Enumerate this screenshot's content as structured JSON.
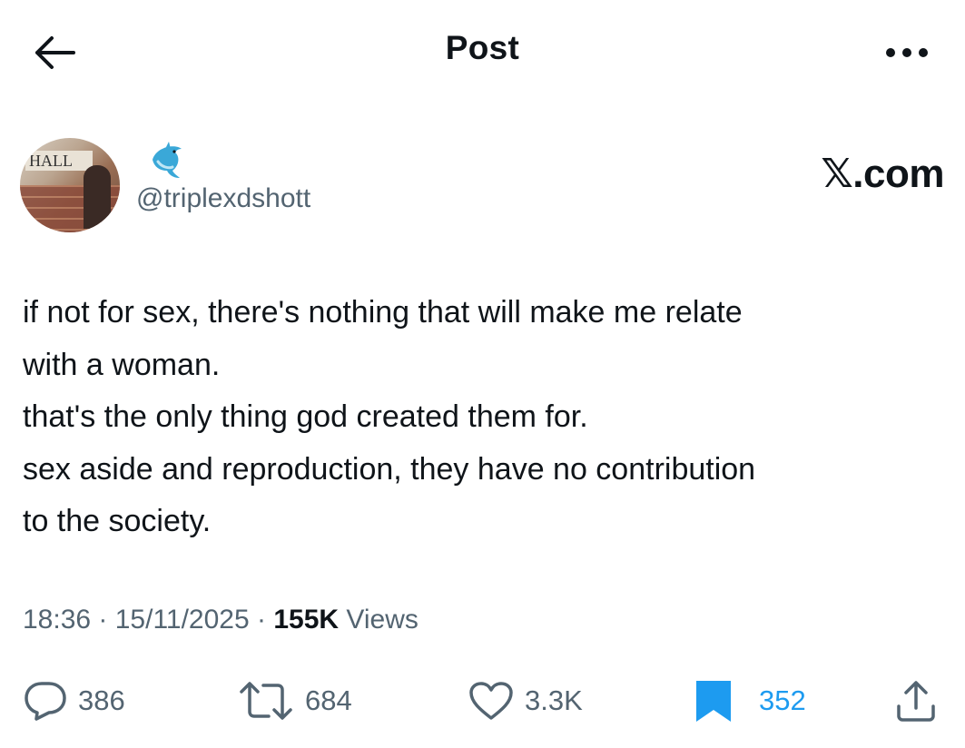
{
  "header": {
    "title": "Post",
    "back_icon": "arrow-left-icon",
    "more_icon": "more-horizontal-icon"
  },
  "author": {
    "handle": "@triplexdshott",
    "avatar_sign": "HALL",
    "badge_icon": "dolphin-emoji"
  },
  "brand": "𝕏.com",
  "post": {
    "lines": [
      "if not for sex, there's nothing that will make me relate",
      "with a woman.",
      "that's the only thing god created them for.",
      "sex aside and reproduction, they have no contribution",
      "to the society."
    ]
  },
  "meta": {
    "time": "18:36",
    "date": "15/11/2025",
    "views_count": "155K",
    "views_label": "Views"
  },
  "actions": {
    "replies": "386",
    "reposts": "684",
    "likes": "3.3K",
    "bookmarks": "352",
    "bookmark_color": "#1d9bf0",
    "icon_color": "#536471"
  }
}
